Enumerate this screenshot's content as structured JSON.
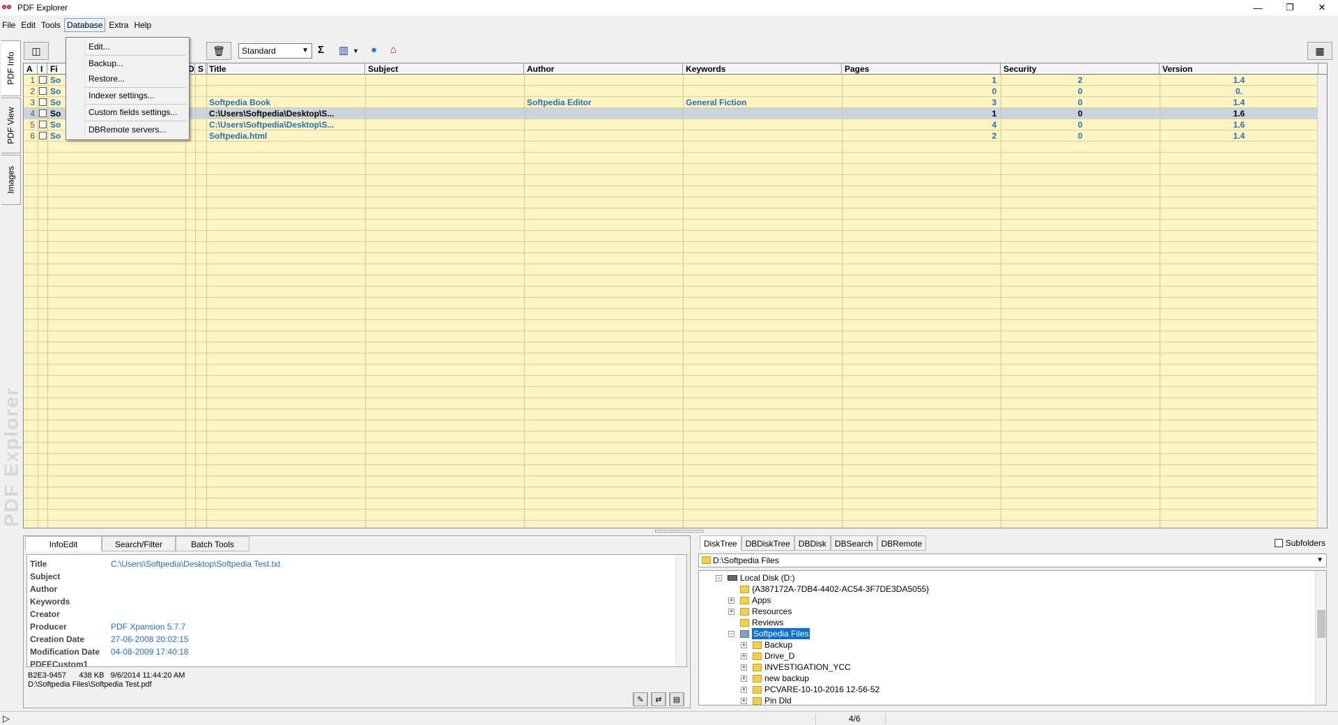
{
  "window": {
    "title": "PDF Explorer",
    "controls": {
      "minimize": "—",
      "restore": "❐",
      "close": "✕"
    }
  },
  "menubar": [
    "File",
    "Edit",
    "Tools",
    "Database",
    "Extra",
    "Help"
  ],
  "database_menu": [
    "Edit...",
    "Backup...",
    "Restore...",
    "Indexer settings...",
    "Custom fields settings...",
    "DBRemote servers..."
  ],
  "toolbar": {
    "view_combo": "Standard"
  },
  "left_tabs": [
    "PDF Info",
    "PDF View",
    "Images"
  ],
  "watermark": "PDF Explorer",
  "grid": {
    "columns": [
      "A",
      "I",
      "Fi",
      "D",
      "S",
      "Title",
      "Subject",
      "Author",
      "Keywords",
      "Pages",
      "Security",
      "Version"
    ],
    "rows": [
      {
        "n": "1",
        "file": "So",
        "title": "",
        "subject": "",
        "author": "",
        "keywords": "",
        "pages": "1",
        "security": "2",
        "version": "1.4"
      },
      {
        "n": "2",
        "file": "So",
        "title": "",
        "subject": "",
        "author": "",
        "keywords": "",
        "pages": "0",
        "security": "0",
        "version": "0."
      },
      {
        "n": "3",
        "file": "So",
        "title": "Softpedia Book",
        "subject": "",
        "author": "Softpedia Editor",
        "keywords": "General Fiction",
        "pages": "3",
        "security": "0",
        "version": "1.4"
      },
      {
        "n": "4",
        "file": "So",
        "title": "C:\\Users\\Softpedia\\Desktop\\S...",
        "subject": "",
        "author": "",
        "keywords": "",
        "pages": "1",
        "security": "0",
        "version": "1.6"
      },
      {
        "n": "5",
        "file": "So",
        "title": "C:\\Users\\Softpedia\\Desktop\\S...",
        "subject": "",
        "author": "",
        "keywords": "",
        "pages": "4",
        "security": "0",
        "version": "1.6"
      },
      {
        "n": "6",
        "file": "So",
        "title": "Softpedia.html",
        "subject": "",
        "author": "",
        "keywords": "",
        "pages": "2",
        "security": "0",
        "version": "1.4"
      }
    ],
    "selected_row": 4
  },
  "left_panel": {
    "tabs": [
      "InfoEdit",
      "Search/Filter",
      "Batch Tools"
    ],
    "fields": [
      {
        "k": "Title",
        "v": "C:\\Users\\Softpedia\\Desktop\\Softpedia Test.txt"
      },
      {
        "k": "Subject",
        "v": ""
      },
      {
        "k": "Author",
        "v": ""
      },
      {
        "k": "Keywords",
        "v": ""
      },
      {
        "k": "Creator",
        "v": ""
      },
      {
        "k": "Producer",
        "v": "PDF Xpansion 5.7.7"
      },
      {
        "k": "Creation Date",
        "v": "27-06-2008 20:02:15"
      },
      {
        "k": "Modification Date",
        "v": "04-08-2009 17:40:18"
      },
      {
        "k": "PDFECustom1",
        "v": ""
      }
    ],
    "status_line1": "B2E3-9457      438 KB   9/6/2014 11:44:20 AM",
    "status_line2": "D:\\Softpedia Files\\Softpedia Test.pdf"
  },
  "right_panel": {
    "tabs": [
      "DiskTree",
      "DBDiskTree",
      "DBDisk",
      "DBSearch",
      "DBRemote"
    ],
    "subfolders_label": "Subfolders",
    "path": "D:\\Softpedia Files",
    "tree": [
      {
        "label": "Local Disk (D:)",
        "exp": "-",
        "depth": 0,
        "type": "drive"
      },
      {
        "label": "{A387172A-7DB4-4402-AC54-3F7DE3DA5055}",
        "exp": "",
        "depth": 1,
        "type": "folder"
      },
      {
        "label": "Apps",
        "exp": "+",
        "depth": 1,
        "type": "folder"
      },
      {
        "label": "Resources",
        "exp": "+",
        "depth": 1,
        "type": "folder"
      },
      {
        "label": "Reviews",
        "exp": "",
        "depth": 1,
        "type": "folder"
      },
      {
        "label": "Softpedia Files",
        "exp": "-",
        "depth": 1,
        "type": "folder-selected"
      },
      {
        "label": "Backup",
        "exp": "+",
        "depth": 2,
        "type": "folder"
      },
      {
        "label": "Drive_D",
        "exp": "+",
        "depth": 2,
        "type": "folder"
      },
      {
        "label": "INVESTIGATION_YCC",
        "exp": "+",
        "depth": 2,
        "type": "folder"
      },
      {
        "label": "new backup",
        "exp": "+",
        "depth": 2,
        "type": "folder"
      },
      {
        "label": "PCVARE-10-10-2016 12-56-52",
        "exp": "+",
        "depth": 2,
        "type": "folder"
      },
      {
        "label": "Pin Dld",
        "exp": "+",
        "depth": 2,
        "type": "folder"
      }
    ]
  },
  "statusbar": {
    "page": "4/6"
  },
  "colors": {
    "grid_bg": "#fdf4c1",
    "link_blue": "#1f6fc4",
    "selected_row": "#cbd3de",
    "tree_selection": "#0a6fd6"
  }
}
